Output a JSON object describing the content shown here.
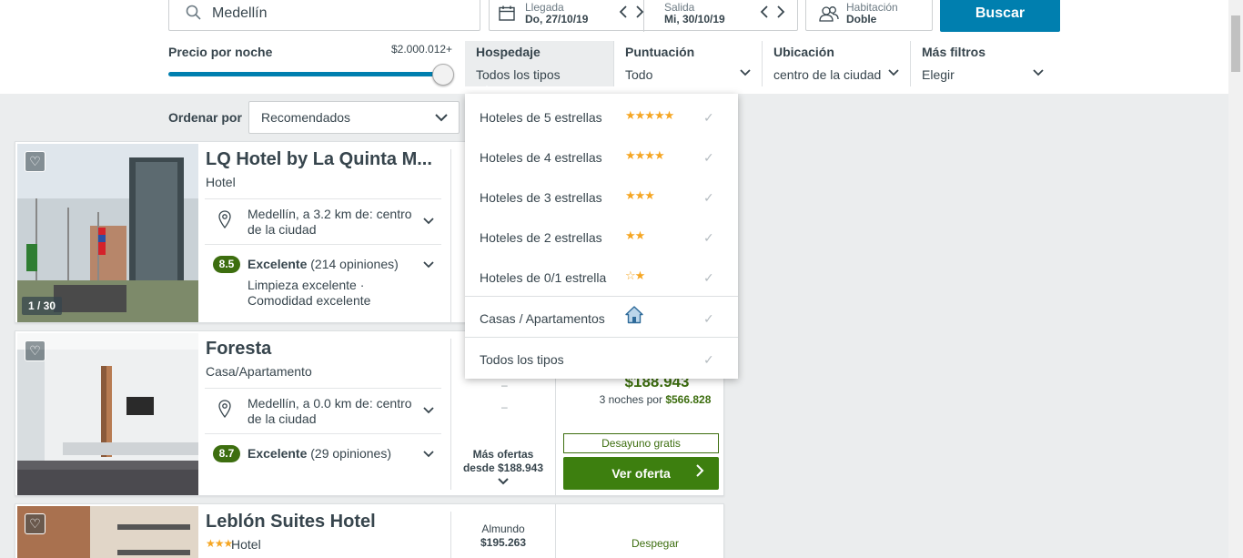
{
  "search": {
    "destination": "Medellín",
    "checkin_label": "Llegada",
    "checkin_value": "Do, 27/10/19",
    "checkout_label": "Salida",
    "checkout_value": "Mi, 30/10/19",
    "room_label": "Habitación",
    "room_value": "Doble",
    "submit_label": "Buscar"
  },
  "filters": {
    "price_label": "Precio por noche",
    "price_value": "$2.000.012+",
    "price_level_fraction": 1.0,
    "groups": [
      {
        "label": "Hospedaje",
        "value": "Todos los tipos"
      },
      {
        "label": "Puntuación",
        "value": "Todo"
      },
      {
        "label": "Ubicación",
        "value": "centro de la ciudad"
      },
      {
        "label": "Más filtros",
        "value": "Elegir"
      }
    ]
  },
  "sort": {
    "label": "Ordenar por",
    "value": "Recomendados"
  },
  "dropdown": {
    "items": [
      {
        "label": "Hoteles de 5 estrellas",
        "stars": "★★★★★"
      },
      {
        "label": "Hoteles de 4 estrellas",
        "stars": "★★★★"
      },
      {
        "label": "Hoteles de 3 estrellas",
        "stars": "★★★"
      },
      {
        "label": "Hoteles de 2 estrellas",
        "stars": "★★"
      },
      {
        "label": "Hoteles de 0/1 estrella",
        "stars": "☆★"
      },
      {
        "label": "Casas / Apartamentos",
        "icon": "house-icon"
      },
      {
        "label": "Todos los tipos"
      }
    ],
    "check": "✓"
  },
  "results": [
    {
      "name": "LQ Hotel by La Quinta M...",
      "type": "Hotel",
      "photo_counter": "1 / 30",
      "location": "Medellín, a 3.2 km de: centro de la ciudad",
      "score": "8.5",
      "score_label": "Excelente",
      "reviews": "(214 opiniones)",
      "highlights": "Limpieza excelente · Comodidad excelente"
    },
    {
      "name": "Foresta",
      "type": "Casa/Apartamento",
      "location": "Medellín, a 0.0 km de: centro de la ciudad",
      "score": "8.7",
      "score_label": "Excelente",
      "reviews": "(29 opiniones)",
      "price": "$188.943",
      "nights_text": "3 noches por",
      "nights_total": "$566.828",
      "breakfast": "Desayuno gratis",
      "cta": "Ver oferta",
      "more_offers": "Más ofertas",
      "more_offers_from": "desde $188.943",
      "dash": "–"
    },
    {
      "name": "Leblón Suites Hotel",
      "stars": "★★★",
      "type": "Hotel",
      "provider": "Almundo",
      "provider_price": "$195.263",
      "partner": "Despegar"
    }
  ],
  "colors": {
    "accent": "#007faf",
    "good": "#3d6e0f",
    "star": "#f5a623"
  }
}
